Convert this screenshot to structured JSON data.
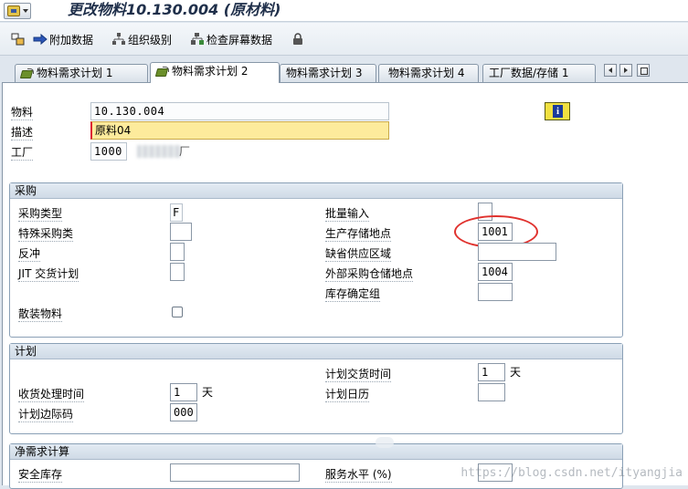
{
  "title": "更改物料10.130.004 (原材料)",
  "toolbar": {
    "additional_data": "附加数据",
    "org_levels": "组织级别",
    "check_screen_data": "检查屏幕数据"
  },
  "tabs": [
    {
      "label": "物料需求计划 1",
      "active": false
    },
    {
      "label": "物料需求计划 2",
      "active": true
    },
    {
      "label": "物料需求计划 3",
      "active": false
    },
    {
      "label": "物料需求计划 4",
      "active": false
    },
    {
      "label": "工厂数据/存储 1",
      "active": false
    }
  ],
  "header": {
    "material_label": "物料",
    "material_value": "10.130.004",
    "desc_label": "描述",
    "desc_value": "原料04",
    "plant_label": "工厂",
    "plant_value": "1000",
    "plant_suffix": "厂"
  },
  "procurement": {
    "title": "采购",
    "proc_type_label": "采购类型",
    "proc_type_value": "F",
    "special_proc_label": "特殊采购类",
    "special_proc_value": "",
    "backflush_label": "反冲",
    "backflush_value": "",
    "jit_label": "JIT 交货计划",
    "jit_value": "",
    "bulk_label": "散装物料",
    "batch_entry_label": "批量输入",
    "batch_entry_value": "",
    "prod_storage_label": "生产存储地点",
    "prod_storage_value": "1001",
    "default_supply_label": "缺省供应区域",
    "default_supply_value": "",
    "ext_storage_label": "外部采购仓储地点",
    "ext_storage_value": "1004",
    "stock_det_label": "库存确定组",
    "stock_det_value": ""
  },
  "planning": {
    "title": "计划",
    "planned_delivery_label": "计划交货时间",
    "planned_delivery_value": "1",
    "planned_delivery_unit": "天",
    "gr_time_label": "收货处理时间",
    "gr_time_value": "1",
    "gr_time_unit": "天",
    "plan_calendar_label": "计划日历",
    "plan_calendar_value": "",
    "sm_key_label": "计划边际码",
    "sm_key_value": "000"
  },
  "net_req": {
    "title": "净需求计算",
    "safety_stock_label": "安全库存",
    "safety_stock_value": "",
    "service_level_label": "服务水平 (%)",
    "service_level_value": ""
  },
  "watermark": "https://blog.csdn.net/ityangjia",
  "colors": {
    "accent_circle": "#e0322e",
    "required_field": "#fdeb9c"
  }
}
